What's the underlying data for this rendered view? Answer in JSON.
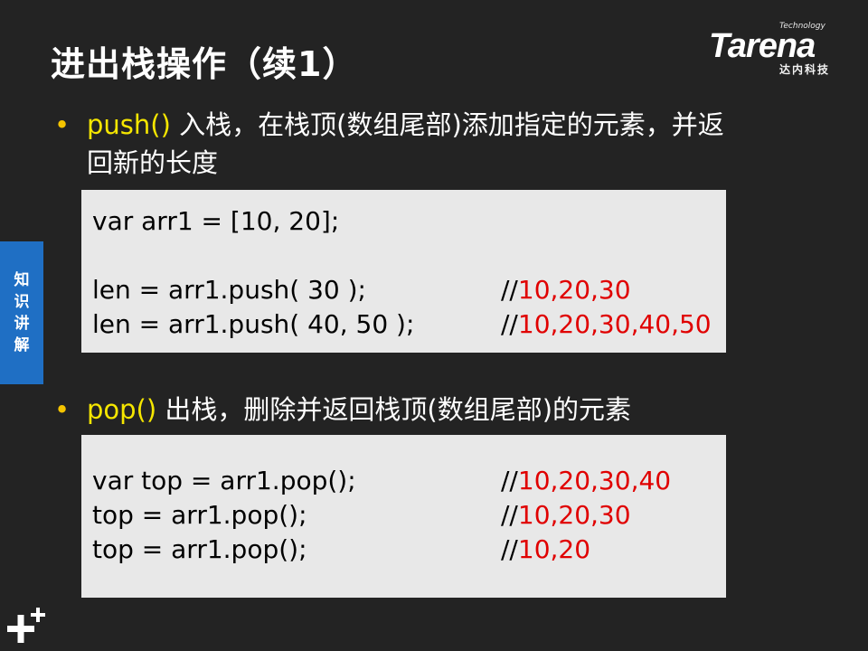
{
  "title": "进出栈操作（续1）",
  "logo": {
    "technology": "Technology",
    "brand": "Tarena",
    "cn": "达内科技"
  },
  "side_tab": [
    "知",
    "识",
    "讲",
    "解"
  ],
  "bullet1": {
    "keyword": "push()",
    "text_line1": " 入栈，在栈顶(数组尾部)添加指定的元素，并返",
    "text_line2": "回新的长度"
  },
  "code1": [
    {
      "code": "var arr1 = [10, 20];",
      "prefix": "",
      "value": ""
    },
    {
      "code": "",
      "prefix": "",
      "value": ""
    },
    {
      "code": "len = arr1.push( 30 );",
      "prefix": "//",
      "value": "10,20,30"
    },
    {
      "code": "len = arr1.push( 40, 50 );",
      "prefix": "//",
      "value": "10,20,30,40,50"
    }
  ],
  "bullet2": {
    "keyword": "pop()",
    "text": " 出栈，删除并返回栈顶(数组尾部)的元素"
  },
  "code2": [
    {
      "code": "var top = arr1.pop();",
      "prefix": "//",
      "value": "10,20,30,40"
    },
    {
      "code": "top = arr1.pop();",
      "prefix": "//",
      "value": "10,20,30"
    },
    {
      "code": "top = arr1.pop();",
      "prefix": "//",
      "value": "10,20"
    }
  ],
  "colors": {
    "background": "#232323",
    "keyword": "#f5e600",
    "bullet": "#f5c400",
    "comment_value": "#e00000",
    "side_tab": "#1f6fc4",
    "code_bg": "#e8e8e8"
  }
}
